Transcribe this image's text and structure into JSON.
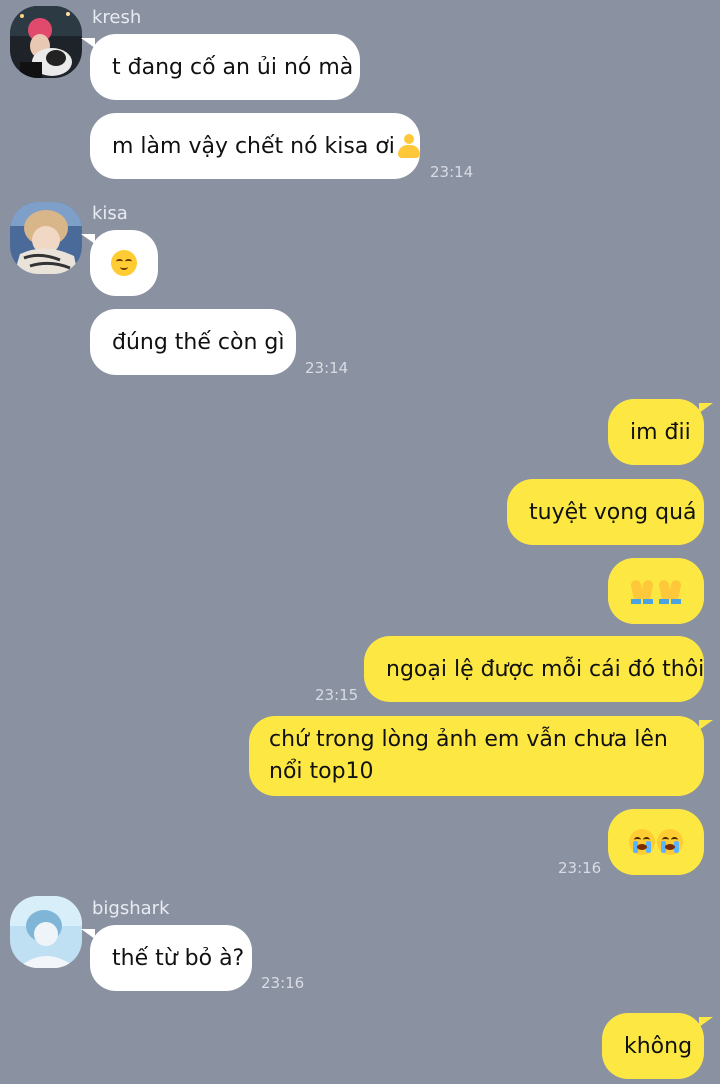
{
  "conversation": {
    "kresh": {
      "name": "kresh",
      "messages": [
        "t đang cố an ủi nó mà",
        "m làm vậy chết nó kisa ơi"
      ],
      "time": "23:14"
    },
    "kisa": {
      "name": "kisa",
      "messages": [
        "đúng thế còn gì"
      ],
      "emoji": "relieved-face-emoji",
      "time": "23:14"
    },
    "me_block1": {
      "messages": [
        "im đii",
        "tuyệt vọng quá",
        "ngoại lệ được mỗi cái đó thôi"
      ],
      "emoji": "folded-hands-emoji",
      "time": "23:15"
    },
    "me_block2": {
      "messages": [
        "chứ trong lòng ảnh em vẫn chưa lên nổi top10"
      ],
      "emoji": "loudly-crying-face-emoji",
      "time": "23:16"
    },
    "bigshark": {
      "name": "bigshark",
      "messages": [
        "thế từ bỏ à?"
      ],
      "time": "23:16"
    },
    "me_block3": {
      "messages": [
        "không"
      ]
    }
  },
  "colors": {
    "background": "#8a91a1",
    "incoming_bubble": "#ffffff",
    "outgoing_bubble": "#fde843"
  }
}
